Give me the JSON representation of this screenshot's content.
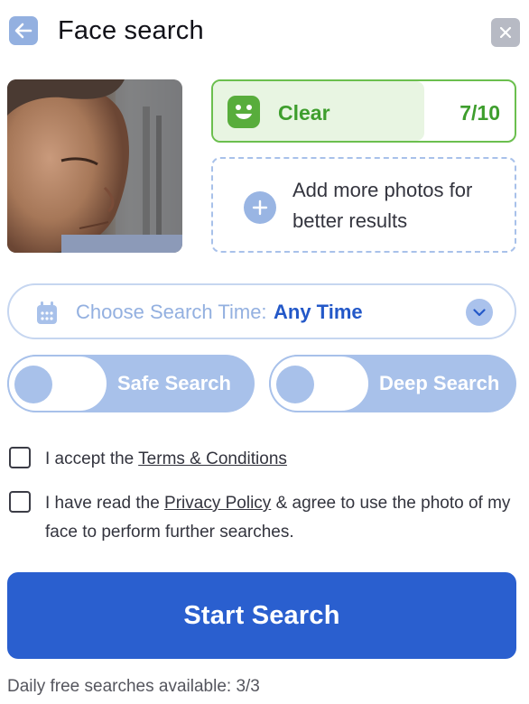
{
  "header": {
    "title": "Face search",
    "back_icon": "arrow-left-icon",
    "close_icon": "close-icon"
  },
  "photo": {
    "alt": "Uploaded face photo"
  },
  "quality": {
    "label": "Clear",
    "score": "7/10",
    "fill_fraction": 0.7,
    "icon": "smile-icon",
    "color": "#3e9e2d"
  },
  "add_photos": {
    "text": "Add more photos for better results",
    "icon": "plus-icon"
  },
  "search_time": {
    "prefix": "Choose Search Time:",
    "value": "Any Time",
    "icon": "calendar-icon"
  },
  "toggles": [
    {
      "label": "Safe Search",
      "on": false
    },
    {
      "label": "Deep Search",
      "on": false
    }
  ],
  "terms": {
    "prefix": "I accept the ",
    "link": "Terms & Conditions",
    "checked": false
  },
  "privacy": {
    "prefix": "I have read the ",
    "link": "Privacy Policy",
    "suffix": " & agree to use the photo of my face to perform further searches.",
    "checked": false
  },
  "start_button": {
    "label": "Start Search",
    "color": "#2a5fcf"
  },
  "daily_searches": "Daily free searches available: 3/3"
}
